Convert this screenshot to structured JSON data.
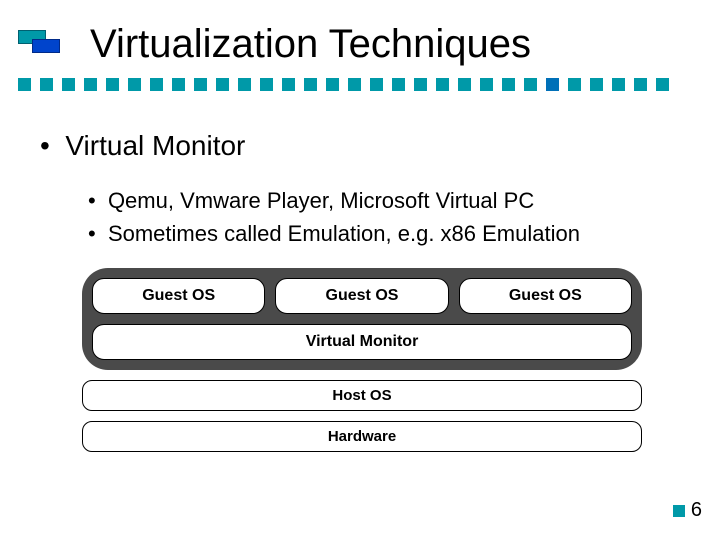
{
  "title": "Virtualization Techniques",
  "bullets": {
    "main": "Virtual Monitor",
    "sub1": "Qemu, Vmware Player, Microsoft Virtual PC",
    "sub2": "Sometimes called Emulation, e.g. x86 Emulation"
  },
  "diagram": {
    "guest1": "Guest OS",
    "guest2": "Guest OS",
    "guest3": "Guest OS",
    "vmon": "Virtual Monitor",
    "host": "Host OS",
    "hw": "Hardware"
  },
  "page": "6",
  "squares": [
    "#0099a8",
    "#0099a8",
    "#0099a8",
    "#0099a8",
    "#0099a8",
    "#0099a8",
    "#0099a8",
    "#0099a8",
    "#0099a8",
    "#0099a8",
    "#0099a8",
    "#0099a8",
    "#0099a8",
    "#0099a8",
    "#0099a8",
    "#0099a8",
    "#0099a8",
    "#0099a8",
    "#0099a8",
    "#0099a8",
    "#0099a8",
    "#0099a8",
    "#0099a8",
    "#0099a8",
    "#0070b8",
    "#0099a8",
    "#0099a8",
    "#0099a8",
    "#0099a8",
    "#0099a8"
  ]
}
